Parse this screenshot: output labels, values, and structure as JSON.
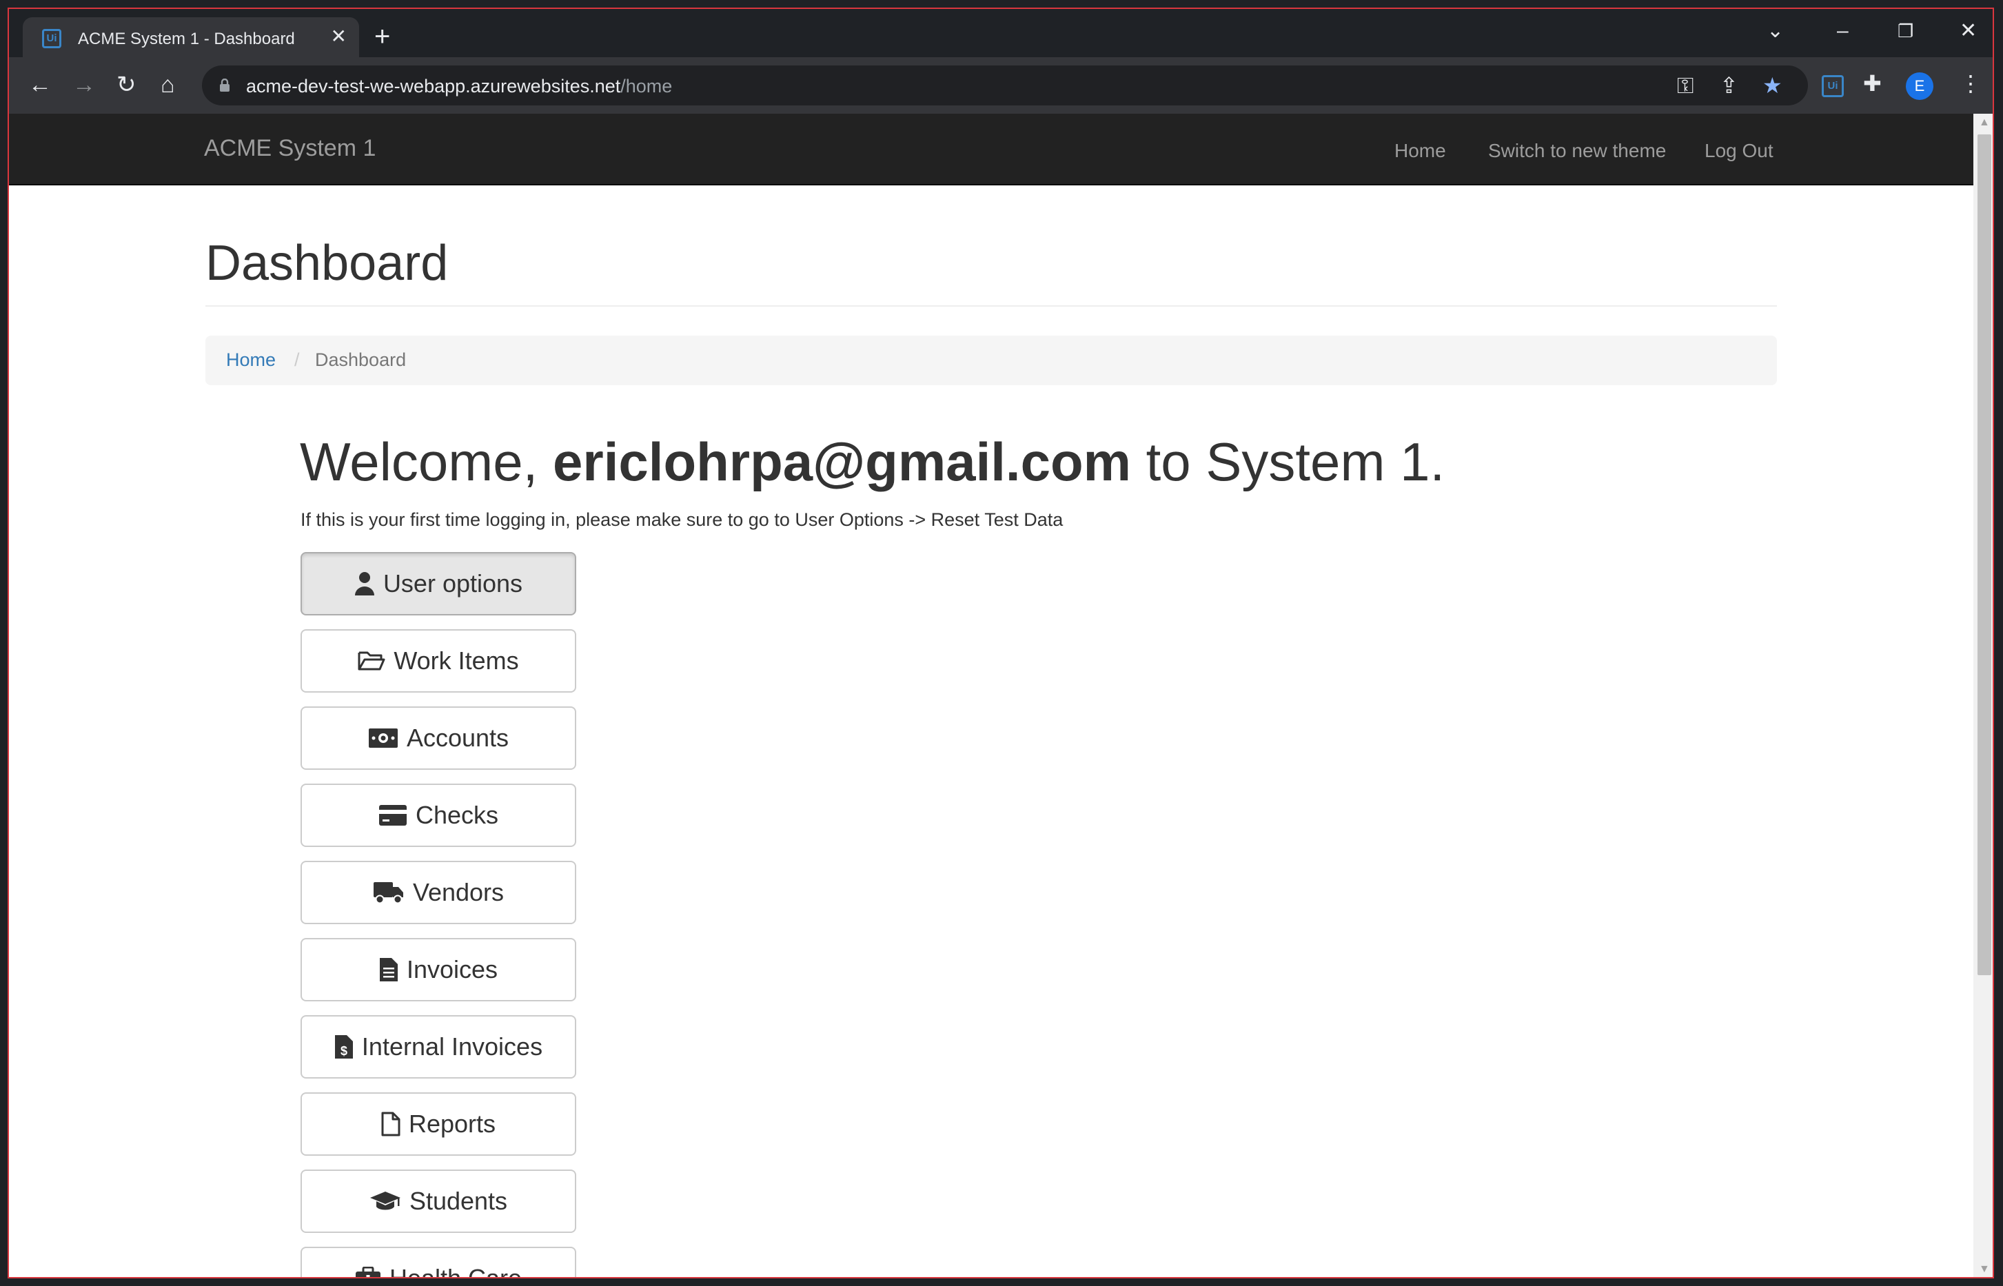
{
  "browser": {
    "tab_title": "ACME System 1 - Dashboard",
    "favicon_text": "Ui",
    "url_host": "acme-dev-test-we-webapp.azurewebsites.net",
    "url_path": "/home",
    "profile_initial": "E"
  },
  "navbar": {
    "brand": "ACME System 1",
    "links": [
      "Home",
      "Switch to new theme",
      "Log Out"
    ]
  },
  "page": {
    "title": "Dashboard",
    "breadcrumb": {
      "home": "Home",
      "separator": "/",
      "current": "Dashboard"
    }
  },
  "welcome": {
    "prefix": "Welcome, ",
    "user": "ericlohrpa@gmail.com",
    "suffix": " to System 1.",
    "note": "If this is your first time logging in, please make sure to go to User Options -> Reset Test Data"
  },
  "buttons": [
    {
      "label": "User options",
      "icon": "user-icon"
    },
    {
      "label": "Work Items",
      "icon": "folder-open-icon"
    },
    {
      "label": "Accounts",
      "icon": "money-icon"
    },
    {
      "label": "Checks",
      "icon": "credit-card-icon"
    },
    {
      "label": "Vendors",
      "icon": "truck-icon"
    },
    {
      "label": "Invoices",
      "icon": "file-text-icon"
    },
    {
      "label": "Internal Invoices",
      "icon": "file-invoice-dollar-icon"
    },
    {
      "label": "Reports",
      "icon": "file-icon"
    },
    {
      "label": "Students",
      "icon": "graduation-cap-icon"
    },
    {
      "label": "Health Care",
      "icon": "medkit-icon"
    }
  ],
  "colors": {
    "navbar_bg": "#222222",
    "link": "#337ab7",
    "frame_border": "#d9363e",
    "chrome_dark": "#35363a"
  }
}
